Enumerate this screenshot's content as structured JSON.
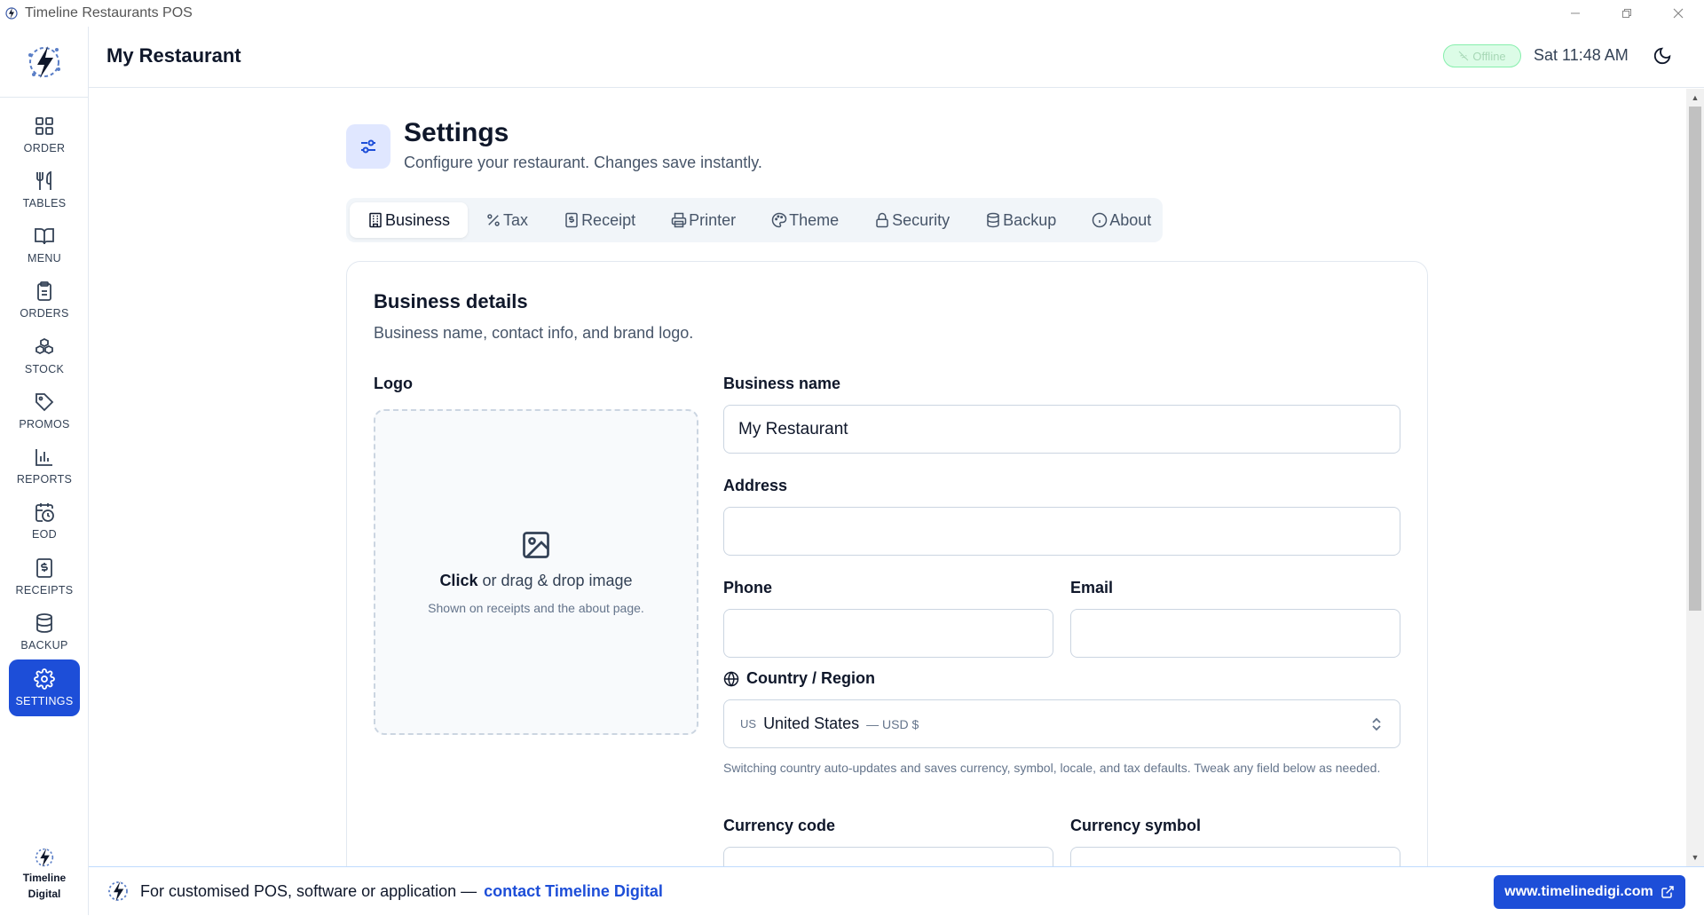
{
  "window": {
    "title": "Timeline Restaurants POS",
    "controls": [
      "minimize",
      "restore",
      "close"
    ]
  },
  "sidebar": {
    "items": [
      {
        "label": "ORDER",
        "icon": "grid-icon"
      },
      {
        "label": "TABLES",
        "icon": "utensils-icon"
      },
      {
        "label": "MENU",
        "icon": "book-icon"
      },
      {
        "label": "ORDERS",
        "icon": "clipboard-icon"
      },
      {
        "label": "STOCK",
        "icon": "boxes-icon"
      },
      {
        "label": "PROMOS",
        "icon": "tag-icon"
      },
      {
        "label": "REPORTS",
        "icon": "bar-chart-icon"
      },
      {
        "label": "EOD",
        "icon": "calendar-clock-icon"
      },
      {
        "label": "RECEIPTS",
        "icon": "receipt-icon"
      },
      {
        "label": "BACKUP",
        "icon": "database-icon"
      },
      {
        "label": "SETTINGS",
        "icon": "gear-icon",
        "active": true
      }
    ],
    "footer": {
      "line1": "Timeline",
      "line2": "Digital"
    }
  },
  "header": {
    "restaurant_name": "My Restaurant",
    "status": "Offline",
    "clock": "Sat 11:48 AM"
  },
  "page": {
    "title": "Settings",
    "subtitle": "Configure your restaurant. Changes save instantly."
  },
  "tabs": [
    {
      "label": "Business",
      "icon": "building-icon",
      "active": true
    },
    {
      "label": "Tax",
      "icon": "percent-icon"
    },
    {
      "label": "Receipt",
      "icon": "receipt-icon"
    },
    {
      "label": "Printer",
      "icon": "printer-icon"
    },
    {
      "label": "Theme",
      "icon": "palette-icon"
    },
    {
      "label": "Security",
      "icon": "lock-icon"
    },
    {
      "label": "Backup",
      "icon": "database-icon"
    },
    {
      "label": "About",
      "icon": "info-icon"
    }
  ],
  "business": {
    "title": "Business details",
    "subtitle": "Business name, contact info, and brand logo.",
    "logo_label": "Logo",
    "dropzone_click": "Click",
    "dropzone_rest": " or drag & drop image",
    "dropzone_note": "Shown on receipts and the about page.",
    "name_label": "Business name",
    "name_value": "My Restaurant",
    "address_label": "Address",
    "address_value": "",
    "phone_label": "Phone",
    "phone_value": "",
    "email_label": "Email",
    "email_value": "",
    "country_label": "Country / Region",
    "country_code": "US",
    "country_name": "United States",
    "country_currency": "— USD $",
    "country_hint": "Switching country auto-updates and saves currency, symbol, locale, and tax defaults. Tweak any field below as needed.",
    "currency_code_label": "Currency code",
    "currency_symbol_label": "Currency symbol"
  },
  "footer": {
    "text": "For customised POS, software or application —",
    "link": "contact Timeline Digital",
    "button": "www.timelinedigi.com"
  },
  "colors": {
    "accent": "#1d4ed8",
    "offline_bg": "#dcfce7",
    "border": "#e2e8f0"
  }
}
